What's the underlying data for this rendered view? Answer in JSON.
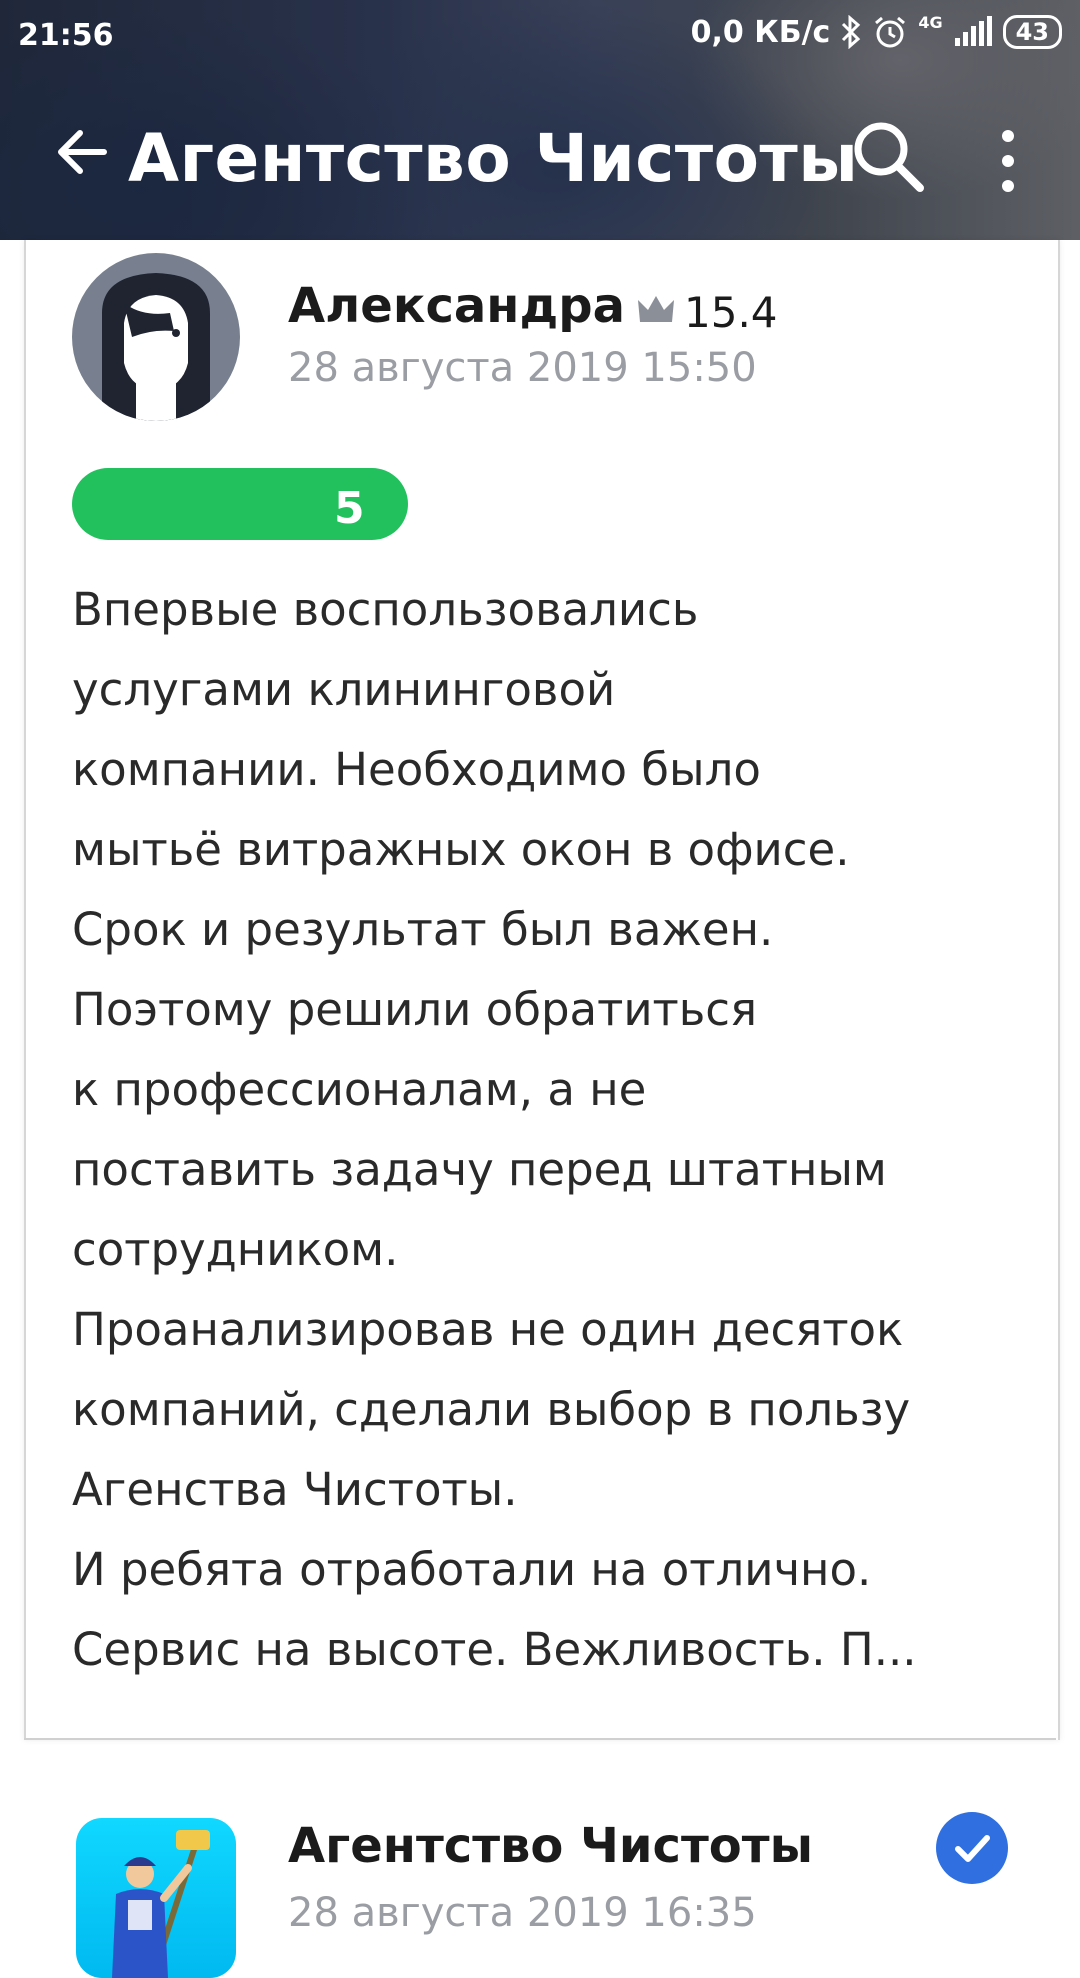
{
  "status_bar": {
    "time": "21:56",
    "network_speed": "0,0 КБ/с",
    "network_type": "4G",
    "battery": "43"
  },
  "toolbar": {
    "title": "Агентство Чистоты",
    "back_icon": "arrow-left-icon",
    "search_icon": "search-icon",
    "more_icon": "more-vert-icon"
  },
  "review": {
    "author": "Александра",
    "author_rating": "15.4",
    "date": "28 августа 2019 15:50",
    "score": "5",
    "score_color": "#23c15e",
    "text": "Впервые воспользовались\nуслугами клининговой\nкомпании. Необходимо было\nмытьё витражных окон в офисе.\nСрок и результат был важен.\nПоэтому решили обратиться\nк профессионалам, а не\nпоставить задачу перед штатным\nсотрудником.\nПроанализировав не один десяток\nкомпаний, сделали выбор в пользу\nАгенства Чистоты.\nИ ребята отработали на отлично.\nСервис на высоте. Вежливость. П..."
  },
  "reply": {
    "author": "Агентство Чистоты",
    "date": "28 августа 2019 16:35",
    "verified_color": "#2f6fe0"
  }
}
